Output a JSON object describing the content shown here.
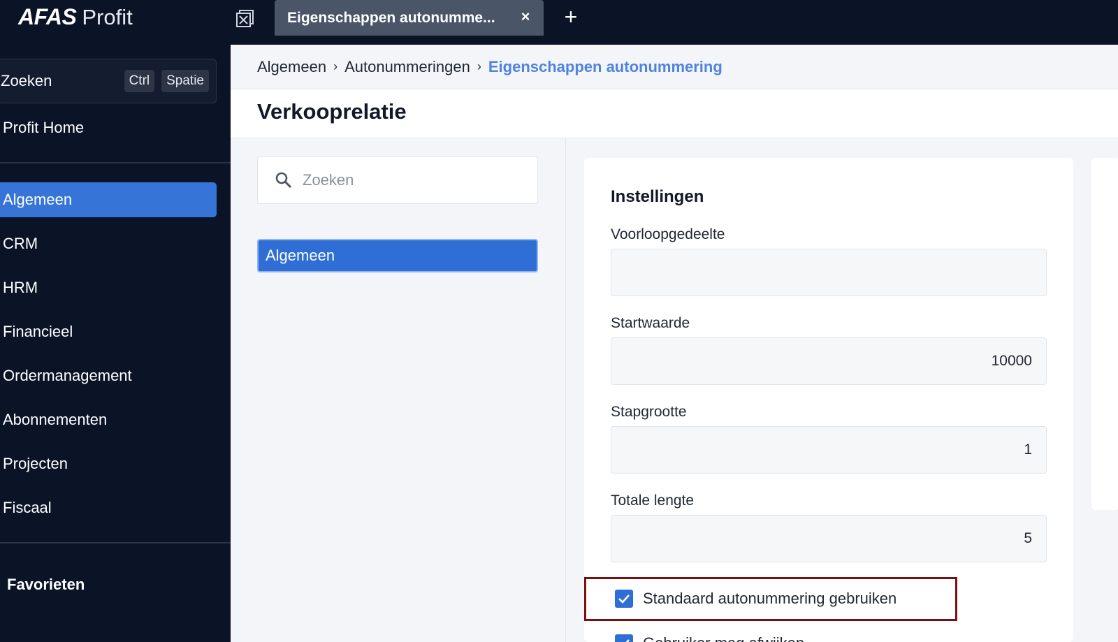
{
  "topbar": {
    "logo_brand": "AFAS",
    "logo_product": "Profit",
    "tab_title": "Eigenschappen autonumme...",
    "tab_close": "×",
    "tab_add": "+"
  },
  "sidebar": {
    "search_label": "Zoeken",
    "shortcut_ctrl": "Ctrl",
    "shortcut_space": "Spatie",
    "home": "Profit Home",
    "items": [
      {
        "label": "Algemeen",
        "active": true
      },
      {
        "label": "CRM"
      },
      {
        "label": "HRM"
      },
      {
        "label": "Financieel"
      },
      {
        "label": "Ordermanagement"
      },
      {
        "label": "Abonnementen"
      },
      {
        "label": "Projecten"
      },
      {
        "label": "Fiscaal"
      }
    ],
    "favorites": "Favorieten"
  },
  "breadcrumb": {
    "items": [
      "Algemeen",
      "Autonummeringen"
    ],
    "current": "Eigenschappen autonummering"
  },
  "page": {
    "title": "Verkooprelatie"
  },
  "left_column": {
    "search_placeholder": "Zoeken",
    "item": "Algemeen"
  },
  "settings": {
    "title": "Instellingen",
    "fields": [
      {
        "label": "Voorloopgedeelte",
        "value": ""
      },
      {
        "label": "Startwaarde",
        "value": "10000"
      },
      {
        "label": "Stapgrootte",
        "value": "1"
      },
      {
        "label": "Totale lengte",
        "value": "5"
      }
    ],
    "checkboxes": [
      {
        "label": "Standaard autonummering gebruiken",
        "checked": true
      },
      {
        "label": "Gebruiker mag afwijken",
        "checked": true
      }
    ]
  },
  "colors": {
    "nav_bg": "#0b1327",
    "accent": "#3674d8",
    "highlight_border": "#7b1010"
  }
}
